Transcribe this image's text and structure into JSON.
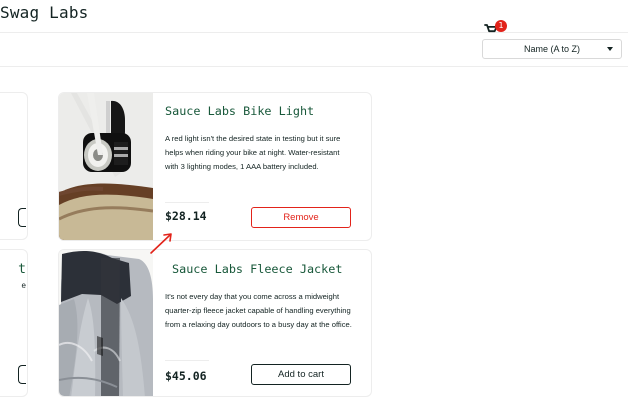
{
  "app": {
    "title": "Swag Labs",
    "cart_badge": "1"
  },
  "toolbar": {
    "sort_value": "Name (A to Z)"
  },
  "left_cards": {
    "top": {
      "title_fragment": "",
      "description_fragment": ""
    },
    "bottom": {
      "title_fragment": "t",
      "description_fragment": "e"
    }
  },
  "products": [
    {
      "name": "Sauce Labs Bike Light",
      "description": "A red light isn't the desired state in testing but it sure helps when riding your bike at night. Water-resistant with 3 lighting modes, 1 AAA battery included.",
      "price": "$28.14",
      "button_label": "Remove"
    },
    {
      "name": "Sauce Labs Fleece Jacket",
      "description": "It's not every day that you come across a midweight quarter-zip fleece jacket capable of handling everything from a relaxing day outdoors to a busy day at the office.",
      "price": "$45.06",
      "button_label": "Add to cart"
    }
  ],
  "colors": {
    "primary_text": "#132322",
    "product_title": "#18583a",
    "remove": "#e2231a",
    "border": "#ededed",
    "badge": "#e2231a"
  },
  "icons": {
    "cart": "shopping-cart-icon",
    "filter": "filter-icon",
    "dropdown": "chevron-down-icon",
    "annotation": "annotation-arrow"
  }
}
